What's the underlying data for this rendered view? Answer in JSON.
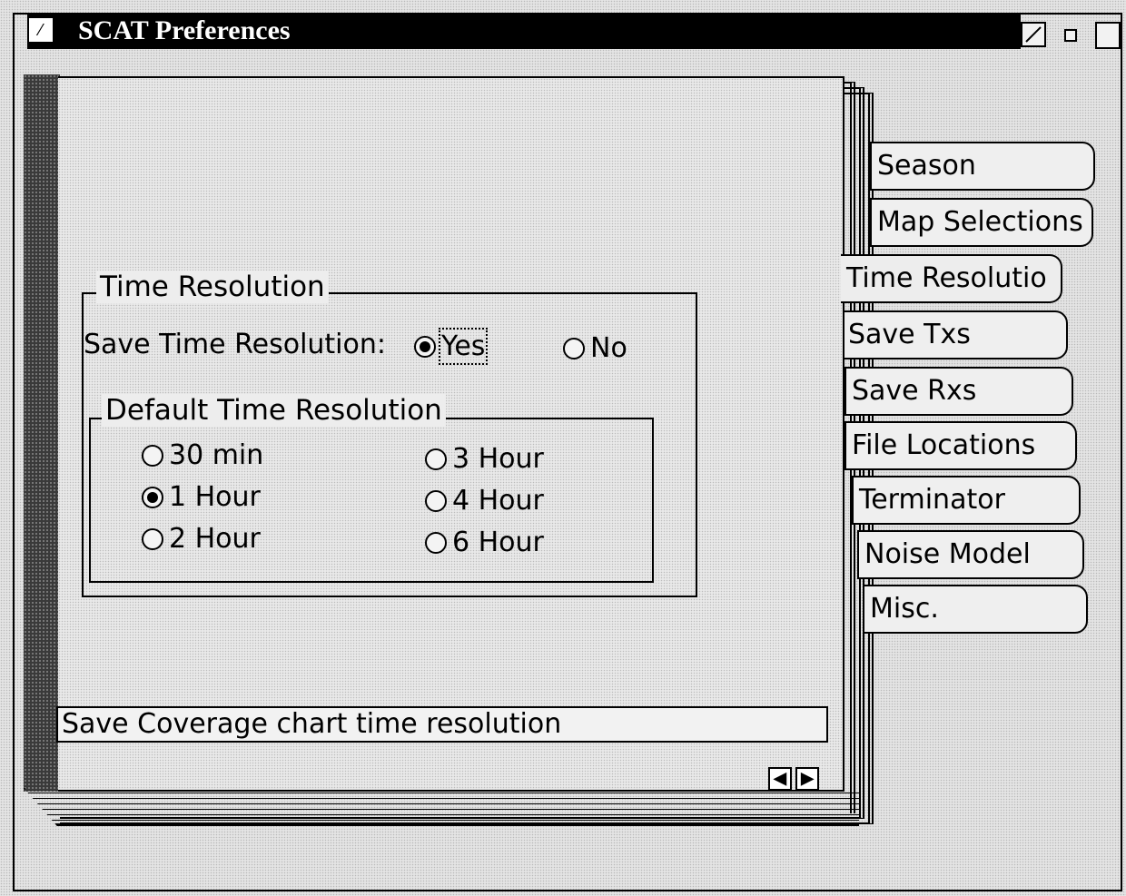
{
  "window": {
    "title": "SCAT Preferences",
    "menu_icon": "window-menu-icon",
    "buttons": [
      "minimize-icon",
      "restore-icon",
      "maximize-icon"
    ]
  },
  "tabs": {
    "items": [
      {
        "label": "Season"
      },
      {
        "label": "Map Selections"
      },
      {
        "label": "Time Resolutio"
      },
      {
        "label": "Save Txs"
      },
      {
        "label": "Save Rxs"
      },
      {
        "label": "File Locations"
      },
      {
        "label": "Terminator"
      },
      {
        "label": "Noise Model"
      },
      {
        "label": "Misc."
      }
    ],
    "active": "Time Resolutio"
  },
  "time_resolution": {
    "group_title": "Time Resolution",
    "save_label": "Save Time Resolution:",
    "save_yes": "Yes",
    "save_no": "No",
    "save_selected": "Yes",
    "default_group_title": "Default Time Resolution",
    "options": [
      "30 min",
      "1 Hour",
      "2 Hour",
      "3 Hour",
      "4 Hour",
      "6 Hour"
    ],
    "selected": "1 Hour"
  },
  "status": {
    "text": "Save Coverage chart time resolution"
  },
  "nav": {
    "prev_icon": "arrow-left-icon",
    "next_icon": "arrow-right-icon"
  }
}
